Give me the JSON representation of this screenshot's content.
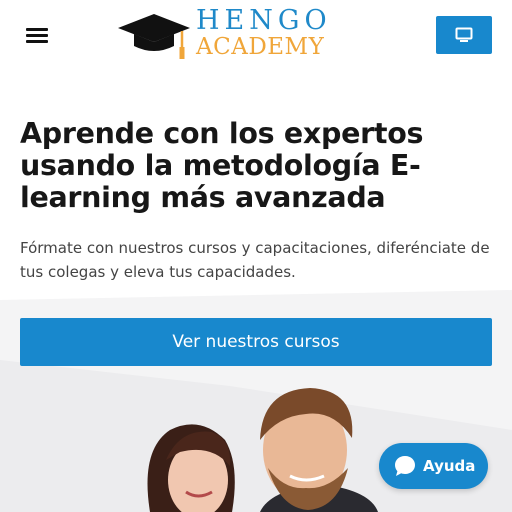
{
  "header": {
    "logo_line1": "HENGO",
    "logo_line2": "ACADEMY",
    "menu_icon": "hamburger-menu-icon",
    "screen_icon": "monitor-icon"
  },
  "hero": {
    "title": "Aprende con los expertos usando la metodología E-learning más avanzada",
    "subtitle": "Fórmate con nuestros cursos y capacitaciones, diferénciate de tus colegas y eleva tus capacidades.",
    "cta_label": "Ver nuestros cursos"
  },
  "help": {
    "label": "Ayuda",
    "icon": "chat-bubble-icon"
  },
  "colors": {
    "primary": "#1888cd",
    "logo_blue": "#1f89c9",
    "logo_orange": "#f0a63a",
    "text_dark": "#171717"
  }
}
